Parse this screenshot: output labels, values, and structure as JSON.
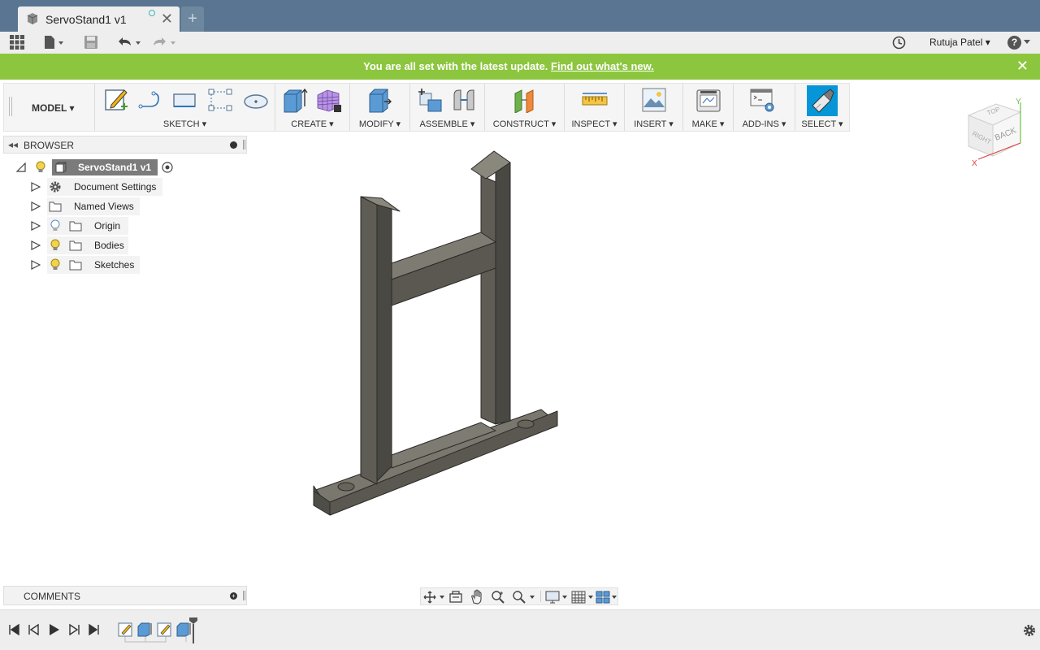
{
  "tab": {
    "title": "ServoStand1 v1",
    "close": "✕",
    "new": "+"
  },
  "qat": {
    "user": "Rutuja Patel ▾",
    "help": "?"
  },
  "banner": {
    "message": "You are all set with the latest update.",
    "link": "Find out what's new.",
    "close": "✕"
  },
  "toolbar": {
    "workspace": "MODEL ▾",
    "groups": [
      {
        "label": "SKETCH ▾"
      },
      {
        "label": "CREATE ▾"
      },
      {
        "label": "MODIFY ▾"
      },
      {
        "label": "ASSEMBLE ▾"
      },
      {
        "label": "CONSTRUCT ▾"
      },
      {
        "label": "INSPECT ▾"
      },
      {
        "label": "INSERT ▾"
      },
      {
        "label": "MAKE ▾"
      },
      {
        "label": "ADD-INS ▾"
      },
      {
        "label": "SELECT ▾"
      }
    ]
  },
  "browser": {
    "title": "BROWSER",
    "root": "ServoStand1 v1",
    "items": [
      {
        "label": "Document Settings",
        "icon": "gear-icon"
      },
      {
        "label": "Named Views",
        "icon": "folder-icon"
      },
      {
        "label": "Origin",
        "icon": "folder-icon"
      },
      {
        "label": "Bodies",
        "icon": "folder-icon"
      },
      {
        "label": "Sketches",
        "icon": "folder-icon"
      }
    ]
  },
  "comments": {
    "title": "COMMENTS"
  },
  "viewcube": {
    "front_face": "BACK",
    "side_face": "RIGHT",
    "top_face": "TOP",
    "axis_x": "X",
    "axis_y": "Y"
  },
  "colors": {
    "tabbar": "#5a7591",
    "banner": "#8cc63f",
    "select_accent": "#0696d7",
    "body": "#5f5c55"
  }
}
